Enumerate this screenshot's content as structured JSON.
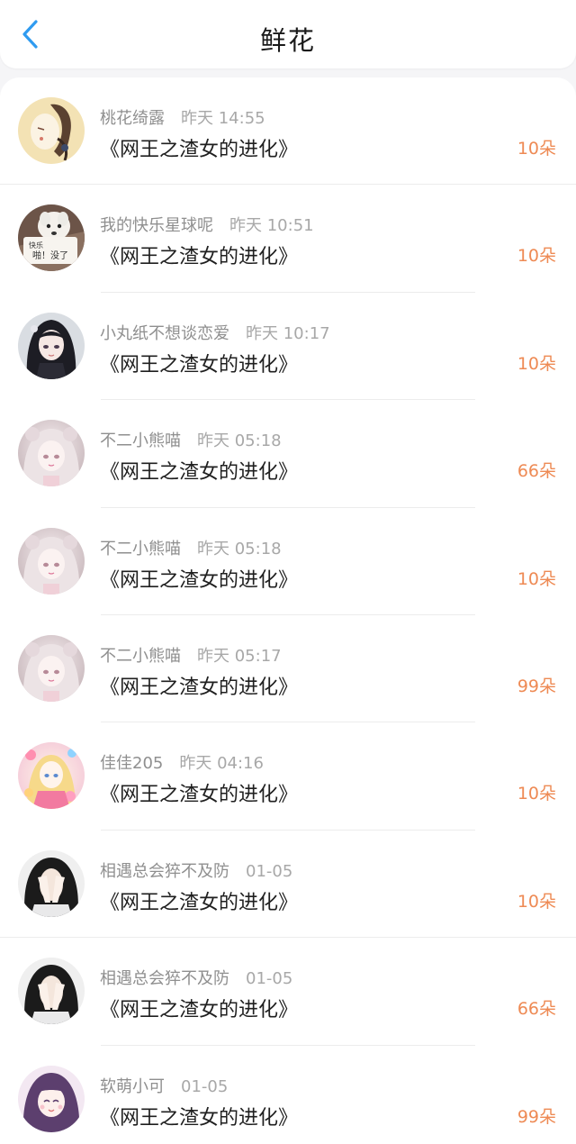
{
  "header": {
    "title": "鲜花",
    "back_icon": "chevron-left-icon",
    "accent_color": "#2f9bf0"
  },
  "amount_color": "#ee8a54",
  "entries": [
    {
      "user": "桃花绮露",
      "time": "昨天 14:55",
      "book": "《网王之渣女的进化》",
      "amount": "10朵",
      "avatar": "portrait-sketch-avatar"
    },
    {
      "user": "我的快乐星球呢",
      "time": "昨天 10:51",
      "book": "《网王之渣女的进化》",
      "amount": "10朵",
      "avatar": "dog-meme-avatar",
      "avatar_caption_1": "快乐",
      "avatar_caption_2": "啪！没了"
    },
    {
      "user": "小丸纸不想谈恋爱",
      "time": "昨天 10:17",
      "book": "《网王之渣女的进化》",
      "amount": "10朵",
      "avatar": "anime-girl-dark-hair-avatar"
    },
    {
      "user": "不二小熊喵",
      "time": "昨天 05:18",
      "book": "《网王之渣女的进化》",
      "amount": "66朵",
      "avatar": "anime-girl-white-hair-avatar"
    },
    {
      "user": "不二小熊喵",
      "time": "昨天 05:18",
      "book": "《网王之渣女的进化》",
      "amount": "10朵",
      "avatar": "anime-girl-white-hair-avatar"
    },
    {
      "user": "不二小熊喵",
      "time": "昨天 05:17",
      "book": "《网王之渣女的进化》",
      "amount": "99朵",
      "avatar": "anime-girl-white-hair-avatar"
    },
    {
      "user": "佳佳205",
      "time": "昨天 04:16",
      "book": "《网王之渣女的进化》",
      "amount": "10朵",
      "avatar": "flower-anime-girl-avatar"
    },
    {
      "user": "相遇总会猝不及防",
      "time": "01-05",
      "book": "《网王之渣女的进化》",
      "amount": "10朵",
      "avatar": "girl-covering-face-avatar"
    },
    {
      "user": "相遇总会猝不及防",
      "time": "01-05",
      "book": "《网王之渣女的进化》",
      "amount": "66朵",
      "avatar": "girl-covering-face-avatar"
    },
    {
      "user": "软萌小可",
      "time": "01-05",
      "book": "《网王之渣女的进化》",
      "amount": "99朵",
      "avatar": "anime-girl-purple-hair-avatar"
    }
  ]
}
